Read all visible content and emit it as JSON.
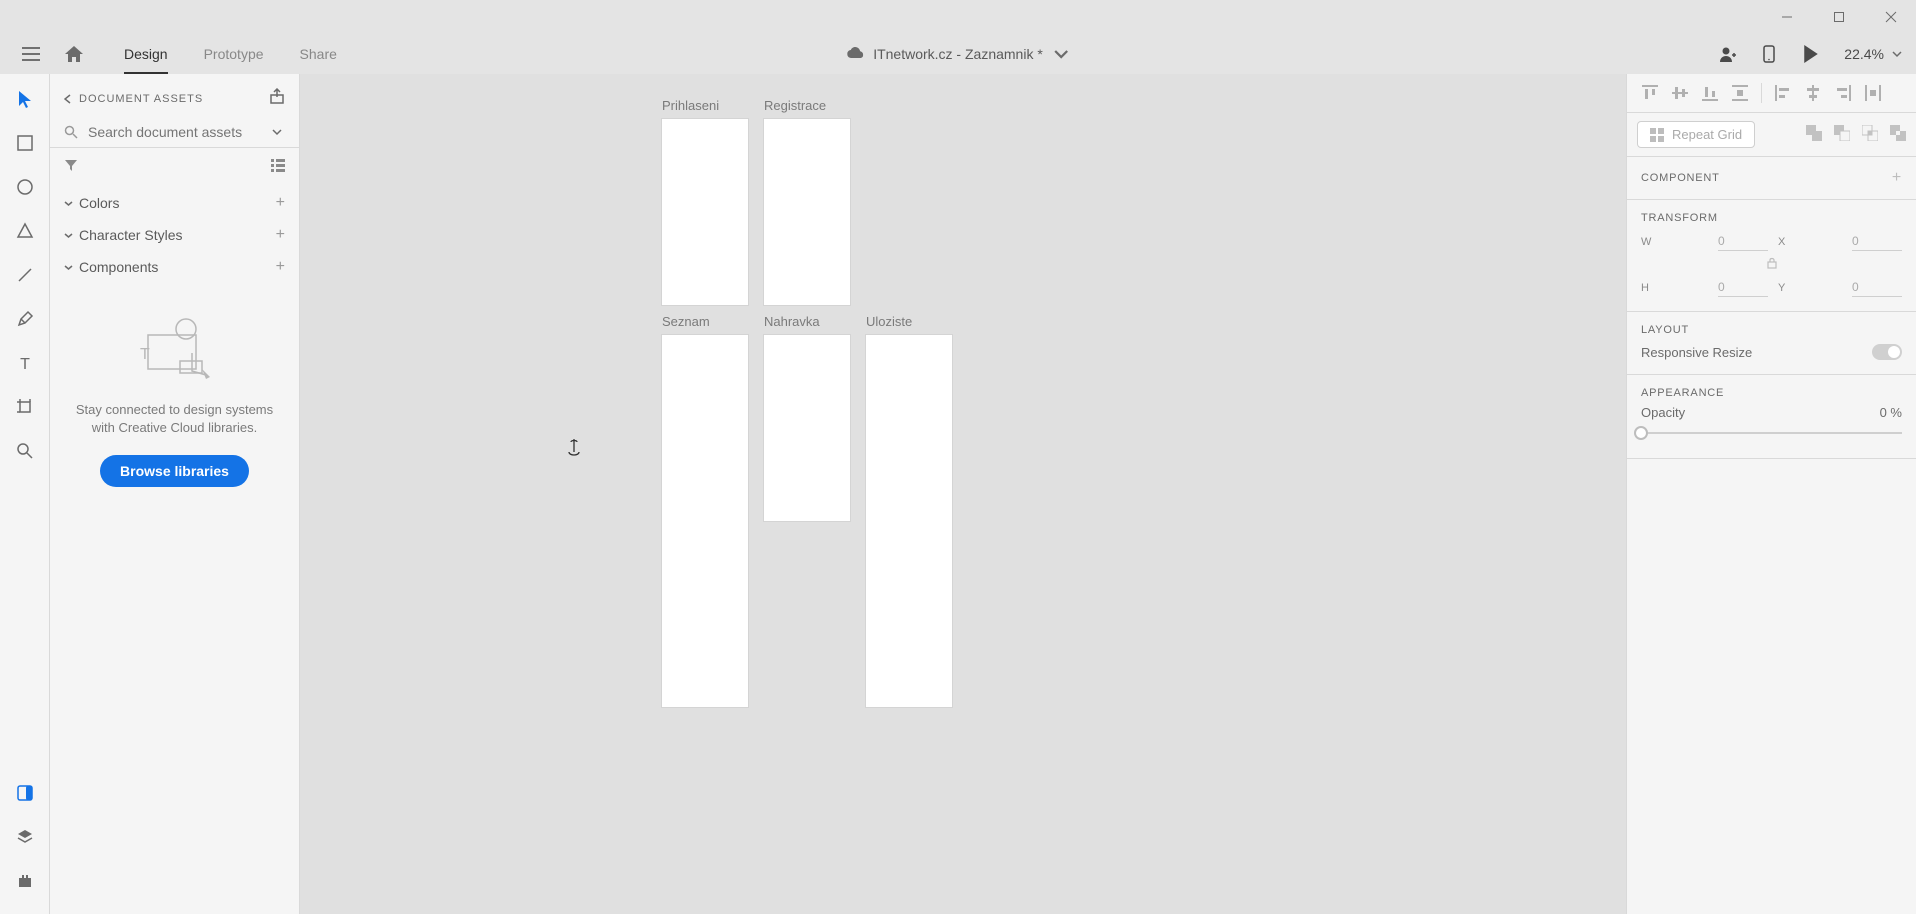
{
  "window": {
    "title": "ITnetwork.cz - Zaznamnik *"
  },
  "tabs": {
    "design": "Design",
    "prototype": "Prototype",
    "share": "Share"
  },
  "zoom": "22.4%",
  "assets": {
    "panel_title": "DOCUMENT ASSETS",
    "search_placeholder": "Search document assets",
    "categories": {
      "colors": "Colors",
      "char_styles": "Character Styles",
      "components": "Components"
    },
    "empty_msg": "Stay connected to design systems with Creative Cloud libraries.",
    "browse_btn": "Browse libraries"
  },
  "artboards": {
    "prihlaseni": "Prihlaseni",
    "registrace": "Registrace",
    "seznam": "Seznam",
    "nahravka": "Nahravka",
    "uloziste": "Uloziste"
  },
  "props": {
    "repeat_grid": "Repeat Grid",
    "component": "COMPONENT",
    "transform": "TRANSFORM",
    "w": "0",
    "h": "0",
    "x": "0",
    "y": "0",
    "layout": "LAYOUT",
    "responsive": "Responsive Resize",
    "appearance": "APPEARANCE",
    "opacity_label": "Opacity",
    "opacity_value": "0 %"
  }
}
